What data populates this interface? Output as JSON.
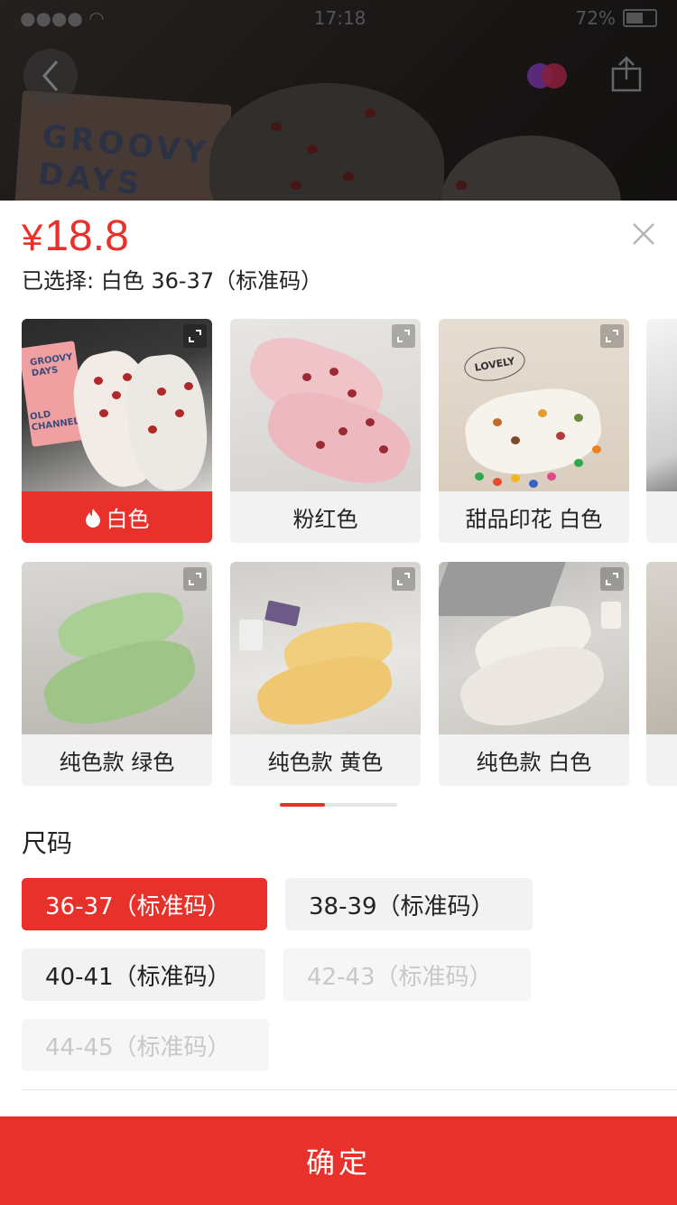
{
  "status_bar": {
    "time": "17:18",
    "battery": "72%"
  },
  "product": {
    "currency_symbol": "¥",
    "price": "18.8",
    "selected_prefix": "已选择:",
    "selected_value": "白色 36-37（标准码）"
  },
  "colors": {
    "accent": "#e8312a",
    "items": [
      {
        "label": "白色",
        "selected": true,
        "icon": "fire-icon"
      },
      {
        "label": "粉红色",
        "selected": false
      },
      {
        "label": "甜品印花 白色",
        "selected": false
      },
      {
        "label": "纯色款 绿色",
        "selected": false
      },
      {
        "label": "纯色款 黄色",
        "selected": false
      },
      {
        "label": "纯色款 白色",
        "selected": false
      }
    ]
  },
  "background_card_text": "GROOVY DAYS",
  "photo_texts": {
    "card1": "GROOVY DAYS",
    "card2": "OLD CHANNEL",
    "badge": "LOVELY"
  },
  "size": {
    "title": "尺码",
    "options": [
      {
        "label": "36-37（标准码）",
        "state": "selected"
      },
      {
        "label": "38-39（标准码）",
        "state": "normal"
      },
      {
        "label": "40-41（标准码）",
        "state": "normal"
      },
      {
        "label": "42-43（标准码）",
        "state": "disabled"
      },
      {
        "label": "44-45（标准码）",
        "state": "disabled"
      }
    ]
  },
  "confirm_label": "确定"
}
